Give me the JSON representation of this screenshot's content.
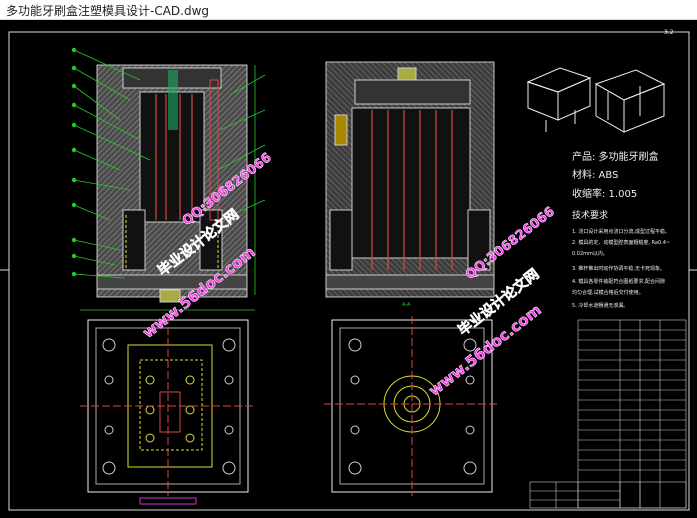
{
  "window": {
    "title": "多功能牙刷盒注塑模具设计-CAD.dwg"
  },
  "drawing": {
    "section_label": "A-A",
    "product_line": "产品: 多功能牙刷盒",
    "material_line": "材料: ABS",
    "shrink_line": "收缩率: 1.005",
    "roughness": "3.2",
    "tech_title": "技术要求",
    "tech_lines": [
      "1. 浇口设计采用点浇口分流,成型过程平稳。",
      "2. 模具的定、动模型腔表面粗糙度, Ra0.4~",
      "0.02mm以内。",
      "3. 推杆推出时动作协调平稳,无卡死现象。",
      "4. 模具各零件装配符合图纸要求,配合间隙",
      "均匀合理,试模合格后交付使用。",
      "5. 冷却水道畅通无渗漏。"
    ],
    "watermark_site": "www.56doc.com",
    "watermark_name": "毕业设计论文网",
    "watermark_qq": "QQ:306826066"
  }
}
